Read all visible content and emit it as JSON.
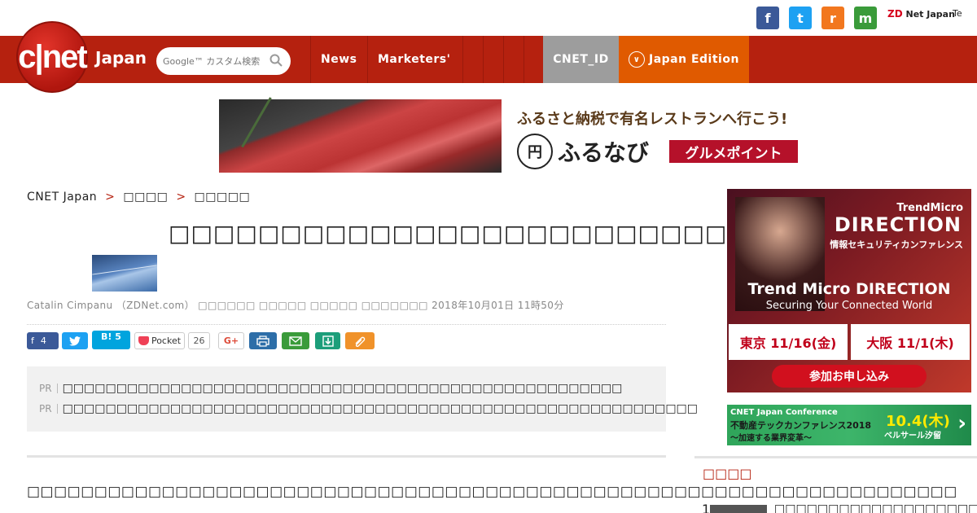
{
  "social": {
    "fb": "f",
    "tw": "t",
    "rss": "r",
    "mail": "m",
    "zd_mark": "ZD",
    "zd_label": "Net Japan",
    "te": "Te"
  },
  "nav": {
    "logo": "c|net",
    "logo_sub": "Japan",
    "search_placeholder": "Google™ カスタム検索",
    "items": [
      "News",
      "Marketers'",
      "",
      "",
      "",
      ""
    ],
    "cnet_id": "CNET_ID",
    "edition": "Japan Edition"
  },
  "banner": {
    "tagline": "ふるさと納税で有名レストランへ行こう!",
    "brand_icon": "円",
    "brand": "ふるなび",
    "badge": "グルメポイント"
  },
  "breadcrumb": [
    "CNET Japan",
    "□□□□",
    "□□□□□"
  ],
  "article": {
    "title": "□□□□□□□□□□□□□□□□□□□□□□□□□□□",
    "byline": "Catalin Cimpanu （ZDNet.com） □□□□□□ □□□□□ □□□□□ □□□□□□□   2018年10月01日 11時50分",
    "body": "□□□□□□□□□□□□□□□□□□□□□□□□□□□□□□□□□□□□□□□□□□□□□□□□□□□□□□□□□□□□□□□□□□□□□"
  },
  "shares": {
    "fb_count": "4",
    "hatena": "B!",
    "hatena_count": "5",
    "pocket": "Pocket",
    "pocket_count": "26",
    "gplus": "G+"
  },
  "pr": {
    "tag": "PR",
    "items": [
      "□□□□□□□□□□□□□□□□□□□□□□□□□□□□□□□□□□□□□□□□□□□□□□□□□□□□",
      "□□□□□□□□□□□□□□□□□□□□□□□□□□□□□□□□□□□□□□□□□□□□□□□□□□□□□□□□□□□"
    ]
  },
  "side_ad": {
    "brand": "TrendMicro",
    "event": "DIRECTION",
    "conf": "情報セキュリティカンファレンス",
    "headline": "Trend Micro DIRECTION",
    "sub": "Securing Your Connected World",
    "city1": "東京 11/16(金)",
    "city2": "大阪 11/1(木)",
    "apply": "参加お申し込み"
  },
  "side_ad2": {
    "l1": "CNET Japan Conference",
    "l2": "不動産テックカンファレンス2018",
    "l3": "〜加速する業界変革〜",
    "date": "10.4(木)",
    "place": "ベルサール汐留",
    "arrow": "›"
  },
  "sidebar": {
    "heading": "□□□□",
    "rank1_num": "1",
    "rank1_title": "□□□□□□□□□□□□□□□□□□□□"
  }
}
